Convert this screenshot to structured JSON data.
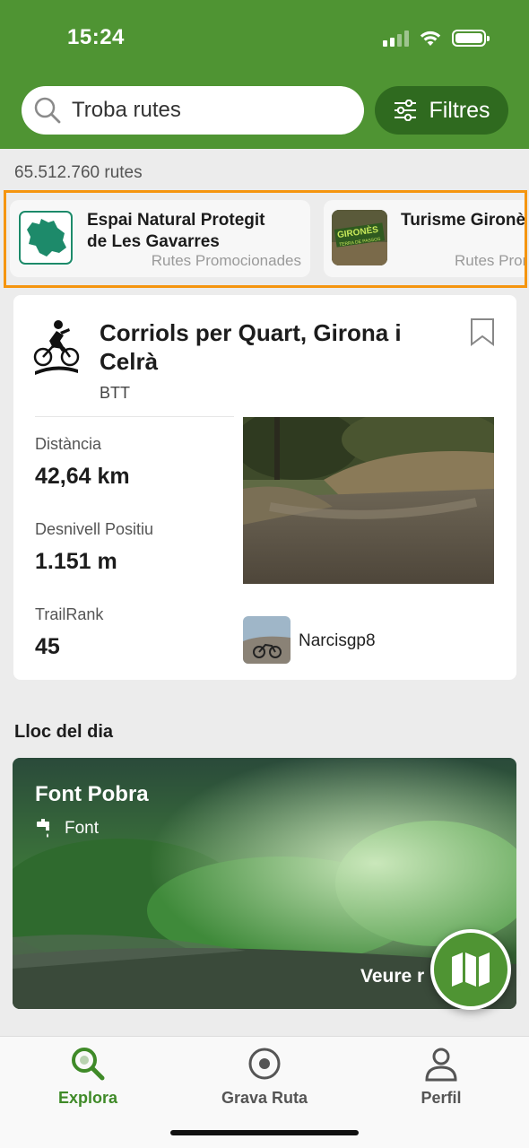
{
  "status_bar": {
    "time": "15:24"
  },
  "search": {
    "placeholder": "Troba rutes"
  },
  "filters": {
    "label": "Filtres"
  },
  "route_count": "65.512.760 rutes",
  "promoted": [
    {
      "title_line1": "Espai Natural Protegit",
      "title_line2": "de Les Gavarres",
      "subtitle": "Rutes Promocionades",
      "logo": "gavarres-map-logo"
    },
    {
      "title_line1": "Turisme Gironès",
      "title_line2": "",
      "subtitle": "Rutes Promocionades",
      "logo_text": "GIRONÈS",
      "logo_subtext": "TERRA DE PASSOS"
    }
  ],
  "route": {
    "title": "Corriols per Quart, Girona i Celrà",
    "activity": "BTT",
    "activity_icon": "mountain-bike-icon",
    "stats": [
      {
        "label": "Distància",
        "value": "42,64 km"
      },
      {
        "label": "Desnivell Positiu",
        "value": "1.151 m"
      },
      {
        "label": "TrailRank",
        "value": "45"
      }
    ],
    "author": "Narcisgp8"
  },
  "place_of_day": {
    "section_title": "Lloc del dia",
    "name": "Font Pobra",
    "type": "Font",
    "type_icon": "water-tap-icon",
    "link": "Veure r"
  },
  "nav": {
    "items": [
      {
        "label": "Explora",
        "icon": "search-icon",
        "active": true
      },
      {
        "label": "Grava Ruta",
        "icon": "record-icon",
        "active": false
      },
      {
        "label": "Perfil",
        "icon": "user-icon",
        "active": false
      }
    ]
  },
  "colors": {
    "brand_green": "#4f9433",
    "dark_green": "#2f6a1f",
    "highlight_orange": "#f5950f",
    "active_nav": "#3f8a28"
  }
}
